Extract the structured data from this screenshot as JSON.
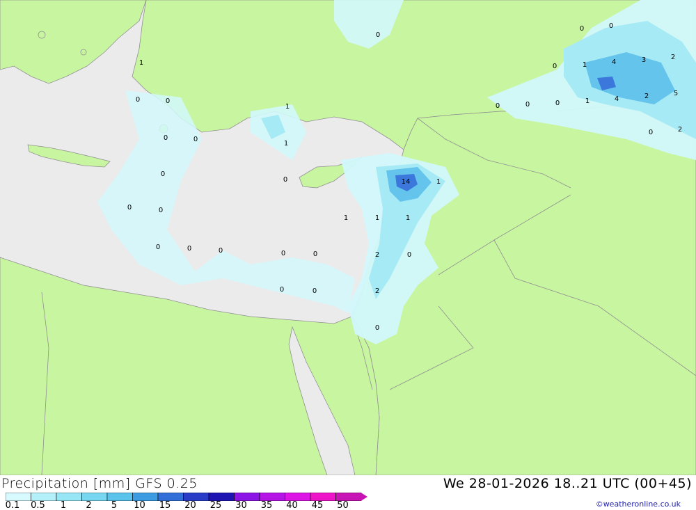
{
  "footer": {
    "title_left": "Precipitation [mm] GFS 0.25",
    "title_right": "We 28-01-2026 18..21 UTC (00+45)",
    "credit": "©weatheronline.co.uk"
  },
  "legend": {
    "ticks": [
      "0.1",
      "0.5",
      "1",
      "2",
      "5",
      "10",
      "15",
      "20",
      "25",
      "30",
      "35",
      "40",
      "45",
      "50"
    ],
    "colors": [
      "#d6fafe",
      "#b4f0fa",
      "#96e6f5",
      "#78d7f0",
      "#5ac3eb",
      "#3c9be1",
      "#326ed7",
      "#283cc8",
      "#1e14b4",
      "#8c14e6",
      "#b414e6",
      "#dc14e6",
      "#f014c8",
      "#c814b4"
    ]
  },
  "map": {
    "colors": {
      "land": "#c8f5a0",
      "sea": "#ebebeb",
      "border": "#909090",
      "precip_light": "#d2f8fc",
      "precip_med": "#a6eaf5",
      "precip_heavy": "#64c4ec",
      "precip_peak": "#3c78dc"
    },
    "labels": [
      "0",
      "1",
      "0",
      "0",
      "0",
      "0",
      "0",
      "0",
      "0",
      "0",
      "0",
      "0",
      "0",
      "0",
      "0",
      "0",
      "0",
      "1",
      "1",
      "0",
      "14",
      "1",
      "1",
      "1",
      "1",
      "2",
      "0",
      "2",
      "0",
      "0",
      "0",
      "0",
      "0",
      "0",
      "1",
      "4",
      "3",
      "2",
      "1",
      "4",
      "2",
      "5",
      "0",
      "2"
    ]
  }
}
